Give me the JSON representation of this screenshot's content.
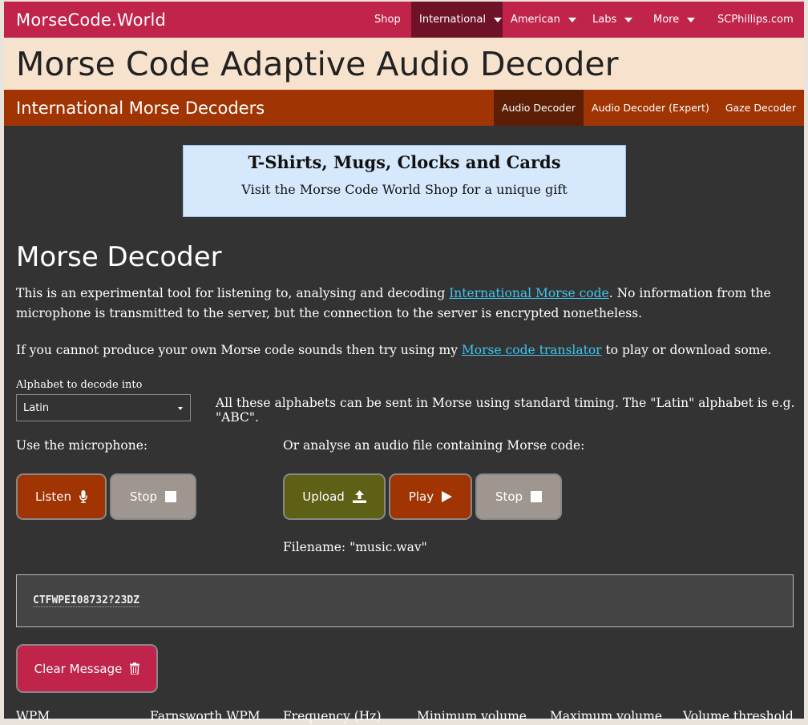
{
  "topnav": {
    "brand": "MorseCode.World",
    "items": [
      {
        "label": "Shop"
      },
      {
        "label": "International"
      },
      {
        "label": "American"
      },
      {
        "label": "Labs"
      },
      {
        "label": "More"
      },
      {
        "label": "SCPhillips.com"
      }
    ]
  },
  "page_title": "Morse Code Adaptive Audio Decoder",
  "subnav": {
    "title": "International Morse Decoders",
    "tabs": [
      {
        "label": "Audio Decoder"
      },
      {
        "label": "Audio Decoder (Expert)"
      },
      {
        "label": "Gaze Decoder"
      }
    ]
  },
  "ad": {
    "title": "T-Shirts, Mugs, Clocks and Cards",
    "text": "Visit the Morse Code World Shop for a unique gift"
  },
  "main": {
    "heading": "Morse Decoder",
    "intro": {
      "pre": "This is an experimental tool for listening to, analysing and decoding ",
      "link": "International Morse code",
      "post": ". No information from the microphone is transmitted to the server, but the connection to the server is encrypted nonetheless."
    },
    "translator": {
      "pre": "If you cannot produce your own Morse code sounds then try using my ",
      "link": "Morse code translator",
      "post": " to play or download some."
    },
    "alphabet_label": "Alphabet to decode into",
    "alphabet_selected": "Latin",
    "alphabet_note": "All these alphabets can be sent in Morse using standard timing. The \"Latin\" alphabet is e.g. \"ABC\".",
    "mic_label": "Use the microphone:",
    "file_label": "Or analyse an audio file containing Morse code:",
    "buttons": {
      "listen": "Listen",
      "stop_mic": "Stop",
      "upload": "Upload",
      "play": "Play",
      "stop_file": "Stop",
      "clear": "Clear Message"
    },
    "filename": "Filename: \"music.wav\"",
    "decoded_text": "CTFWPEI08732?23DZ",
    "settings_headers": [
      "WPM",
      "Farnsworth WPM",
      "Frequency (Hz)",
      "Minimum volume",
      "Maximum volume",
      "Volume threshold"
    ]
  },
  "icons": [
    "caret-down-icon",
    "microphone-icon",
    "stop-icon",
    "upload-icon",
    "play-icon",
    "trash-icon"
  ],
  "colors": {
    "topnav": "#c0244a",
    "title_band": "#f7e3cd",
    "subnav": "#a03403",
    "main_bg": "#333333",
    "link": "#3ec6ee",
    "upload_button": "#5d6015",
    "stop_button": "#9f9690"
  }
}
